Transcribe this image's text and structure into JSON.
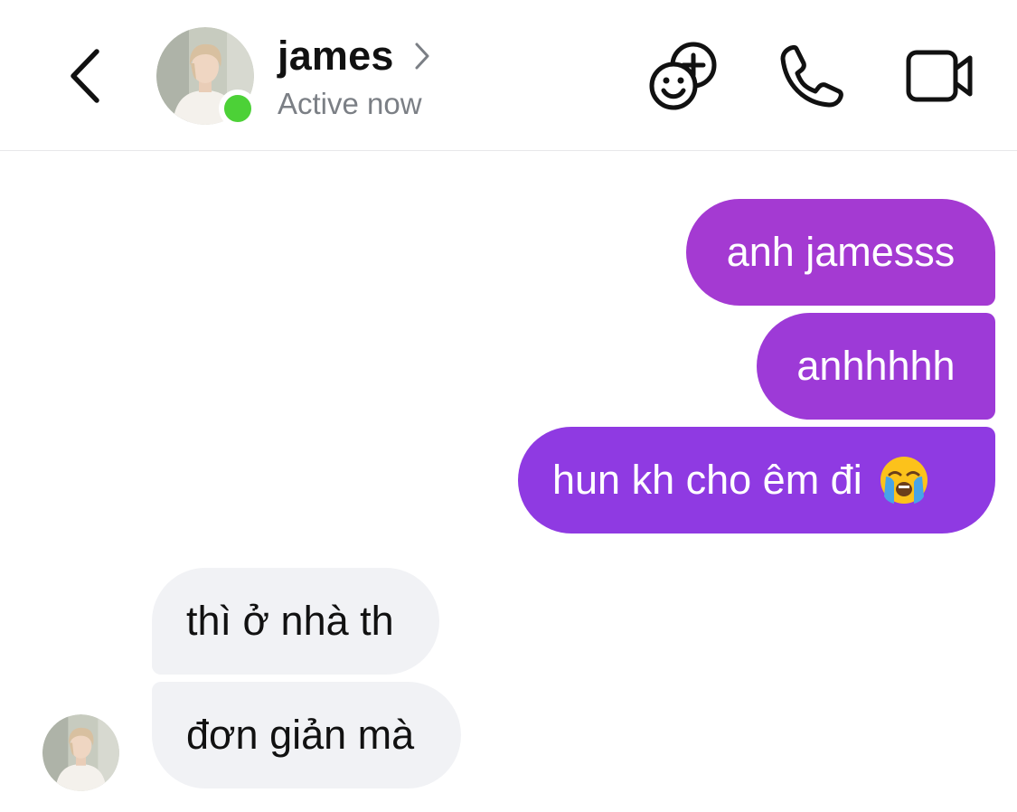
{
  "header": {
    "contact_name": "james",
    "status": "Active now",
    "status_color": "#4cd137",
    "icons": {
      "back": "chevron-left-icon",
      "profile": "chevron-right-icon",
      "games": "games-add-icon",
      "call": "phone-icon",
      "video": "video-camera-icon"
    }
  },
  "messages": [
    {
      "direction": "sent",
      "text": "anh jamesss"
    },
    {
      "direction": "sent",
      "text": "anhhhhh"
    },
    {
      "direction": "sent",
      "text": "hun kh cho êm đi",
      "emoji": "loudly-crying-face"
    },
    {
      "direction": "received",
      "text": "thì ở nhà th"
    },
    {
      "direction": "received",
      "text": "đơn giản mà"
    }
  ],
  "colors": {
    "sent_bubble_gradient": [
      "#a43ad2",
      "#9d3ad7",
      "#8f3ae2"
    ],
    "received_bubble": "#f1f2f5",
    "secondary_text": "#7b7f85"
  }
}
